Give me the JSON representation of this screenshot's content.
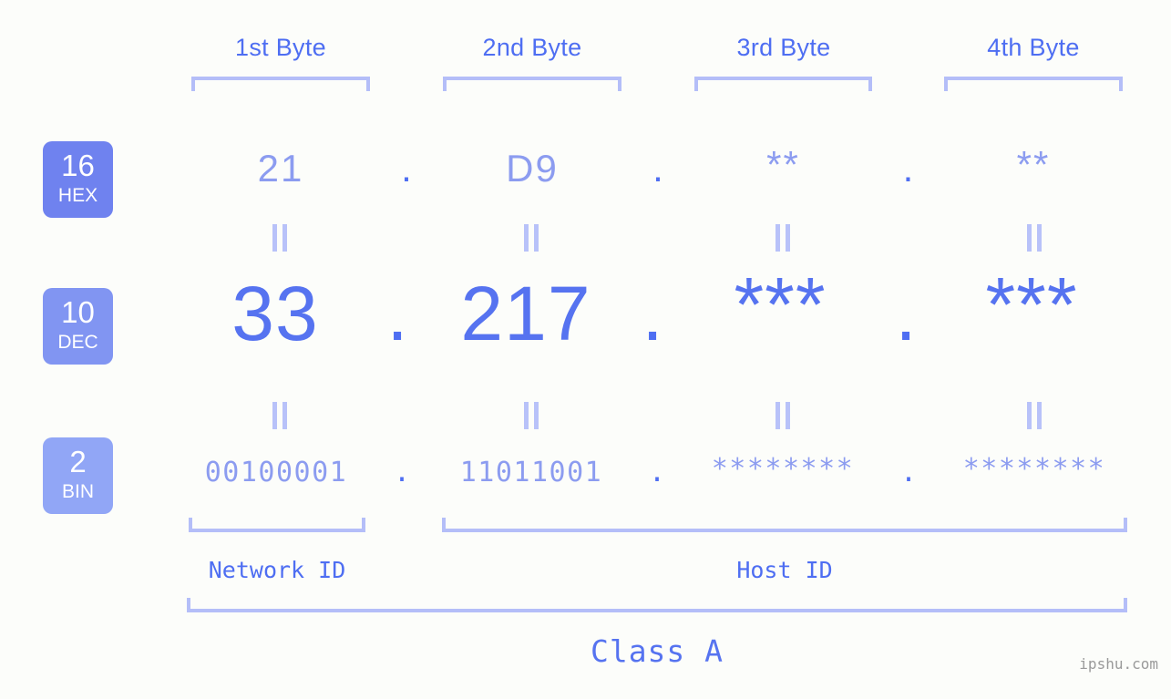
{
  "background": "#fcfdfa",
  "accent": "#4e6ef2",
  "accent_light": "#8c9cf0",
  "bracket_color": "#b4bef8",
  "byte_headers": [
    {
      "label": "1st Byte"
    },
    {
      "label": "2nd Byte"
    },
    {
      "label": "3rd Byte"
    },
    {
      "label": "4th Byte"
    }
  ],
  "rows": {
    "hex": {
      "badge_number": "16",
      "badge_name": "HEX",
      "badge_color": "#6f82ef",
      "values": [
        "21",
        "D9",
        "**",
        "**"
      ],
      "separator": "."
    },
    "dec": {
      "badge_number": "10",
      "badge_name": "DEC",
      "badge_color": "#8195f2",
      "values": [
        "33",
        "217",
        "***",
        "***"
      ],
      "separator": "."
    },
    "bin": {
      "badge_number": "2",
      "badge_name": "BIN",
      "badge_color": "#91a6f6",
      "values": [
        "00100001",
        "11011001",
        "********",
        "********"
      ],
      "separator": "."
    }
  },
  "equals_glyph": "=",
  "footer": {
    "network_id_label": "Network ID",
    "host_id_label": "Host ID",
    "class_label": "Class A"
  },
  "watermark": "ipshu.com"
}
